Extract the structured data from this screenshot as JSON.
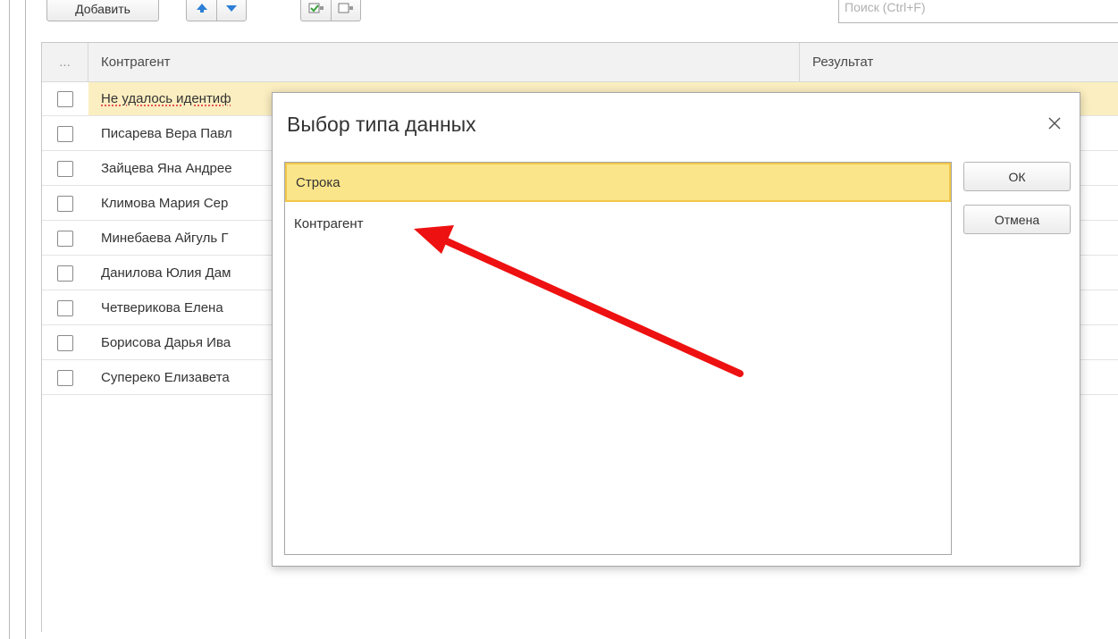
{
  "toolbar": {
    "add_label": "Добавить",
    "search_placeholder": "Поиск (Ctrl+F)"
  },
  "table": {
    "columns": {
      "dots": "...",
      "counterparty": "Контрагент",
      "result": "Результат"
    },
    "rows": [
      {
        "name": "Не удалось идентиф",
        "selected": true
      },
      {
        "name": "Писарева Вера Павл"
      },
      {
        "name": "Зайцева Яна Андрее"
      },
      {
        "name": "Климова Мария Сер"
      },
      {
        "name": "Минебаева Айгуль Г"
      },
      {
        "name": "Данилова Юлия Дам"
      },
      {
        "name": "Четверикова Елена"
      },
      {
        "name": "Борисова Дарья Ива"
      },
      {
        "name": "Супереко Елизавета"
      }
    ]
  },
  "dialog": {
    "title": "Выбор типа данных",
    "close_icon": "close-icon",
    "types": [
      {
        "label": "Строка",
        "selected": true
      },
      {
        "label": "Контрагент"
      }
    ],
    "ok_label": "ОК",
    "cancel_label": "Отмена"
  },
  "annotation": {
    "arrow_color": "#ee1111",
    "icon": "arrow-annotation"
  },
  "colors": {
    "selection": "#fbe58a",
    "selection_border": "#f0c74a",
    "row_highlight": "#fbeec0"
  }
}
